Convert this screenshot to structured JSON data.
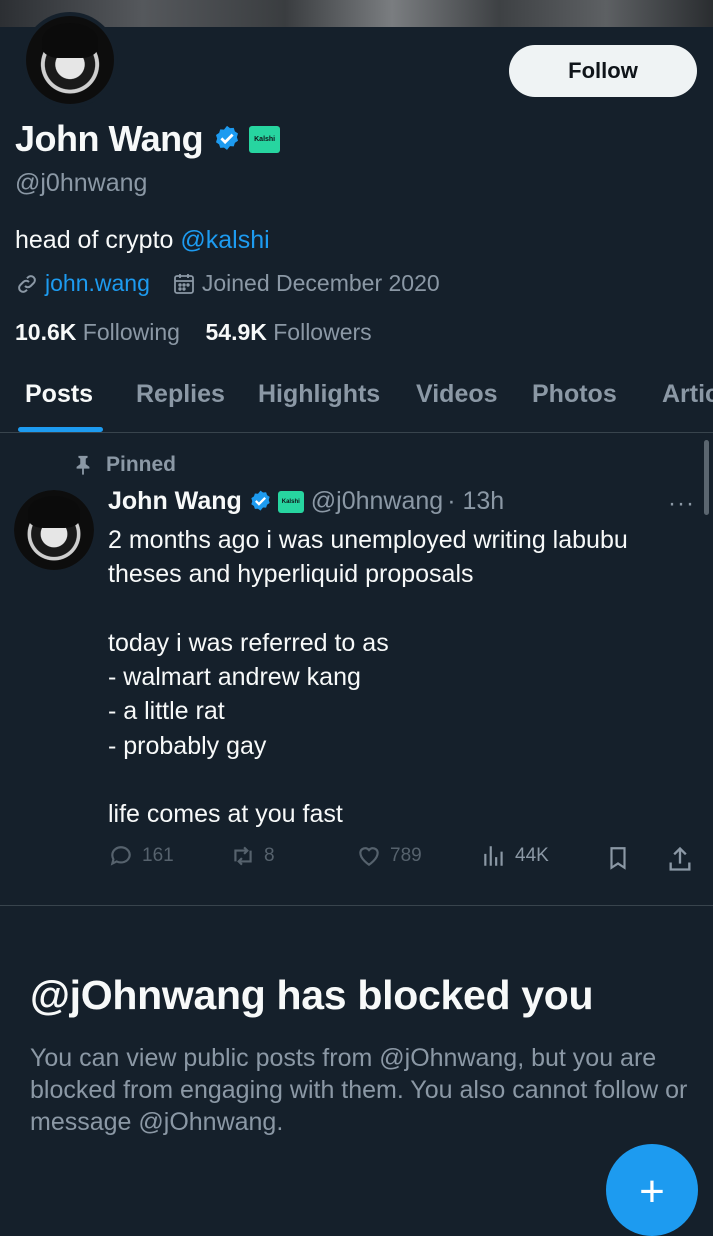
{
  "profile": {
    "name": "John Wang",
    "badge_label": "Kalshi",
    "handle": "@j0hnwang",
    "bio_text": "head of crypto ",
    "bio_mention": "@kalshi",
    "website": "john.wang",
    "joined": "Joined December 2020",
    "following_count": "10.6K",
    "following_label": "Following",
    "followers_count": "54.9K",
    "followers_label": "Followers"
  },
  "header": {
    "follow_label": "Follow"
  },
  "tabs": [
    {
      "label": "Posts"
    },
    {
      "label": "Replies"
    },
    {
      "label": "Highlights"
    },
    {
      "label": "Videos"
    },
    {
      "label": "Photos"
    },
    {
      "label": "Artic"
    }
  ],
  "pinned_post": {
    "pinned_label": "Pinned",
    "author": "John Wang",
    "handle": "@j0hnwang",
    "time": "· 13h",
    "more": "···",
    "text": "2 months ago i was unemployed writing labubu theses and hyperliquid proposals\n\ntoday i was referred to as\n- walmart andrew kang\n- a little rat\n- probably gay\n\nlife comes at you fast",
    "replies": "161",
    "reposts": "8",
    "likes": "789",
    "views": "44K"
  },
  "blocked": {
    "title": "@jOhnwang has blocked you",
    "description": "You can view public posts from @jOhnwang, but you are blocked from engaging with them. You also cannot follow or message @jOhnwang."
  },
  "fab": {
    "icon": "plus-icon"
  },
  "colors": {
    "background": "#15202b",
    "accent": "#1d9bf0",
    "kalshi": "#27d5a0",
    "muted": "#8b98a5"
  }
}
